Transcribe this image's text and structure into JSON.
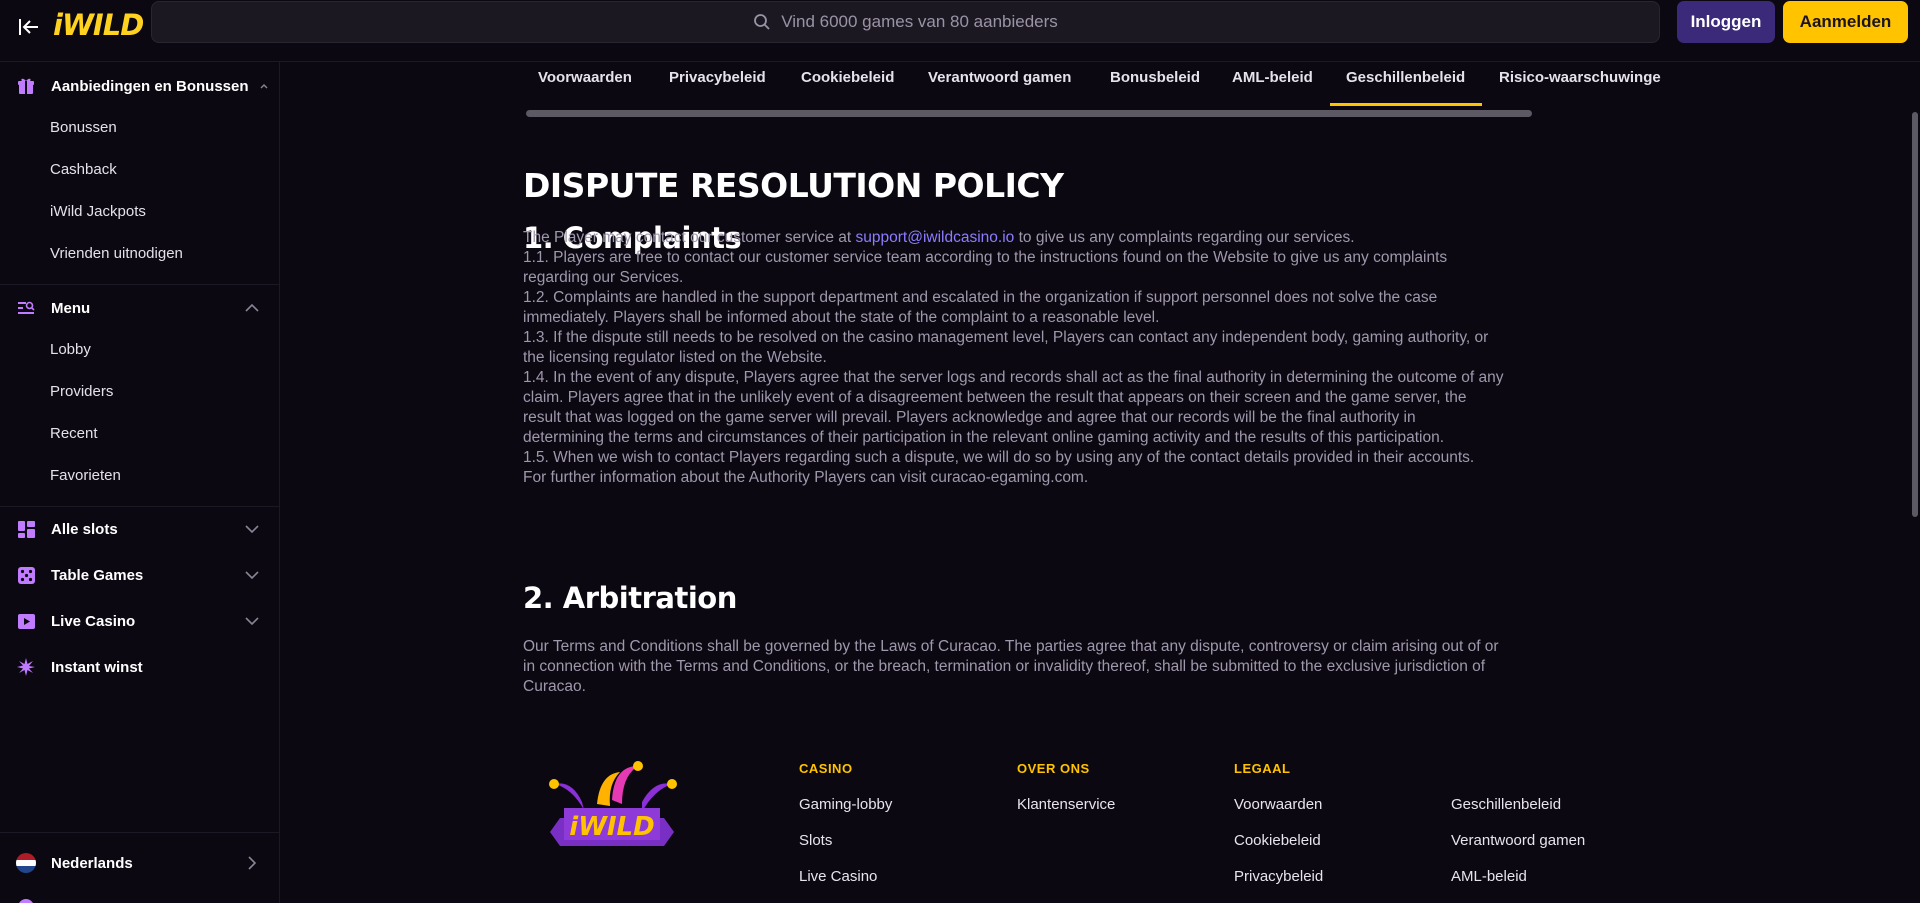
{
  "header": {
    "logo": "iWILD",
    "search_placeholder": "Vind 6000 games van 80 aanbieders",
    "login_label": "Inloggen",
    "register_label": "Aanmelden"
  },
  "sidebar": {
    "offers": {
      "label": "Aanbiedingen en Bonussen",
      "items": [
        "Bonussen",
        "Cashback",
        "iWild Jackpots",
        "Vrienden uitnodigen"
      ]
    },
    "menu": {
      "label": "Menu",
      "items": [
        "Lobby",
        "Providers",
        "Recent",
        "Favorieten"
      ]
    },
    "categories": [
      {
        "label": "Alle slots"
      },
      {
        "label": "Table Games"
      },
      {
        "label": "Live Casino"
      },
      {
        "label": "Instant winst"
      }
    ],
    "language": "Nederlands"
  },
  "tabs": [
    "Voorwaarden",
    "Privacybeleid",
    "Cookiebeleid",
    "Verantwoord gamen",
    "Bonusbeleid",
    "AML-beleid",
    "Geschillenbeleid",
    "Risico-waarschuwinge"
  ],
  "active_tab": "Geschillenbeleid",
  "document": {
    "title": "DISPUTE RESOLUTION POLICY",
    "section1_title": "1. Complaints",
    "section1_intro_before": "The Player may contact our customer service at ",
    "section1_email": "support@iwildcasino.io",
    "section1_intro_after": " to give us any complaints regarding our services.",
    "section1_lines": [
      "1.1. Players are free to contact our customer service team according to the instructions found on the Website to give us any complaints",
      "regarding our Services.",
      "1.2. Complaints are handled in the support department and escalated in the organization if support personnel does not solve the case",
      "immediately. Players shall be informed about the state of the complaint to a reasonable level.",
      "1.3. If the dispute still needs to be resolved on the casino management level, Players can contact any independent body, gaming authority, or",
      "the licensing regulator listed on the Website.",
      "1.4. In the event of any dispute, Players agree that the server logs and records shall act as the final authority in determining the outcome of any",
      "claim. Players agree that in the unlikely event of a disagreement between the result that appears on their screen and the game server, the",
      "result that was logged on the game server will prevail. Players acknowledge and agree that our records will be the final authority in",
      "determining the terms and circumstances of their participation in the relevant online gaming activity and the results of this participation.",
      "1.5. When we wish to contact Players regarding such a dispute, we will do so by using any of the contact details provided in their accounts.",
      "For further information about the Authority Players can visit curacao-egaming.com."
    ],
    "section2_title": "2. Arbitration",
    "section2_lines": [
      "Our Terms and Conditions shall be governed by the Laws of Curacao. The parties agree that any dispute, controversy or claim arising out of or",
      "in connection with the Terms and Conditions, or the breach, termination or invalidity thereof, shall be submitted to the exclusive jurisdiction of",
      "Curacao."
    ]
  },
  "footer": {
    "logo_text": "iWILD",
    "casino": {
      "title": "CASINO",
      "links": [
        "Gaming-lobby",
        "Slots",
        "Live Casino"
      ]
    },
    "about": {
      "title": "OVER ONS",
      "links": [
        "Klantenservice"
      ]
    },
    "legal": {
      "title": "LEGAAL",
      "links_col1": [
        "Voorwaarden",
        "Cookiebeleid",
        "Privacybeleid"
      ],
      "links_col2": [
        "Geschillenbeleid",
        "Verantwoord gamen",
        "AML-beleid"
      ]
    }
  },
  "colors": {
    "accent_yellow": "#ffc300",
    "login_purple": "#3b2a7a",
    "link_blue": "#8b7dff",
    "sidebar_icon": "#c07bff"
  }
}
